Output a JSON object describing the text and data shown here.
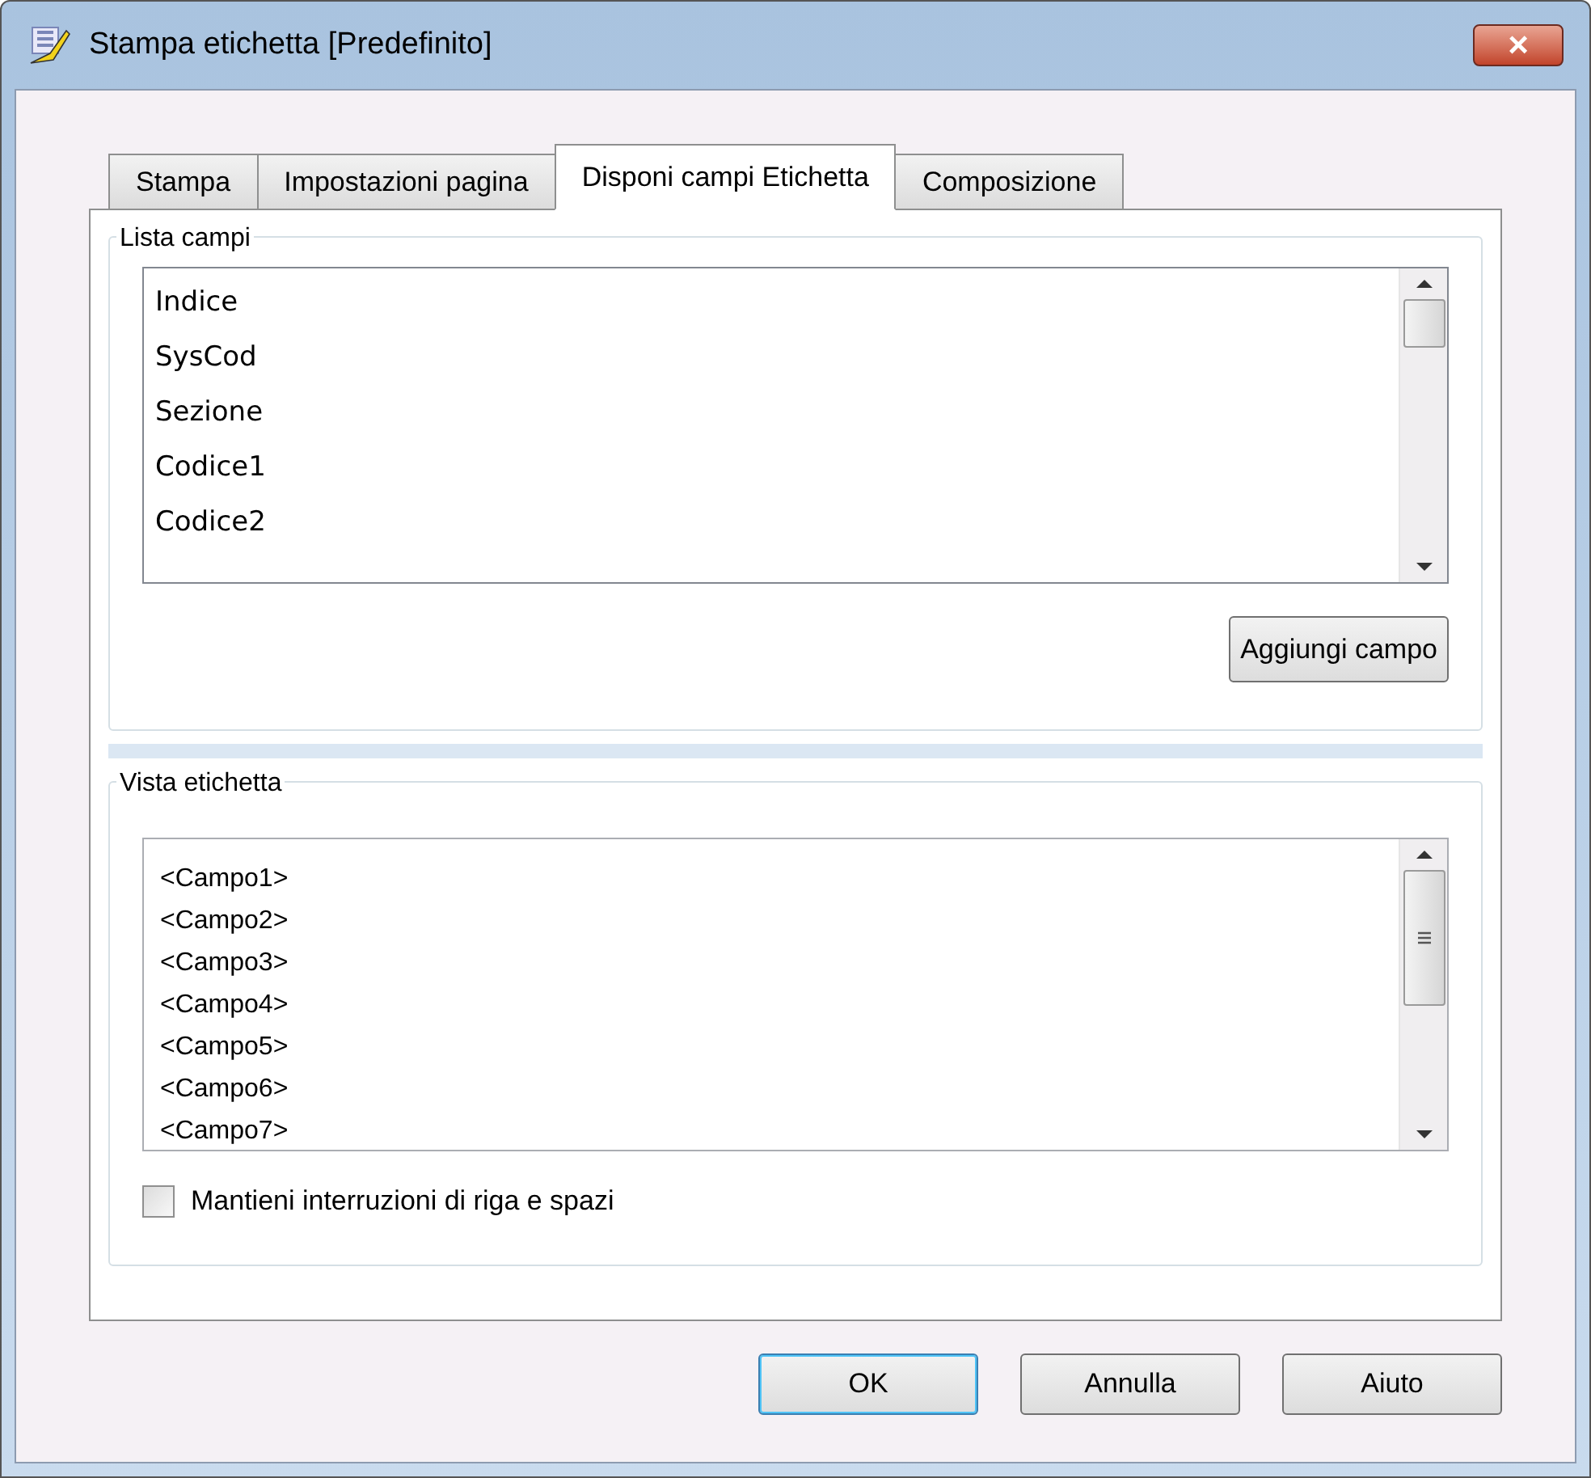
{
  "window": {
    "title": "Stampa etichetta [Predefinito]",
    "close": "×"
  },
  "tabs": [
    {
      "label": "Stampa",
      "selected": false
    },
    {
      "label": "Impostazioni pagina",
      "selected": false
    },
    {
      "label": "Disponi campi Etichetta",
      "selected": true
    },
    {
      "label": "Composizione",
      "selected": false
    }
  ],
  "field_list": {
    "title": "Lista campi",
    "items": [
      "Indice",
      "SysCod",
      "Sezione",
      "Codice1",
      "Codice2"
    ],
    "add_button": "Aggiungi campo"
  },
  "label_view": {
    "title": "Vista etichetta",
    "lines": [
      "<Campo1>",
      "<Campo2>",
      "<Campo3>",
      "<Campo4>",
      "<Campo5>",
      "<Campo6>",
      "<Campo7>"
    ],
    "keep_breaks": {
      "label": "Mantieni interruzioni di riga e spazi",
      "checked": false
    }
  },
  "buttons": [
    {
      "label": "OK",
      "kind": "default"
    },
    {
      "label": "Annulla",
      "kind": "normal"
    },
    {
      "label": "Aiuto",
      "kind": "normal"
    }
  ]
}
